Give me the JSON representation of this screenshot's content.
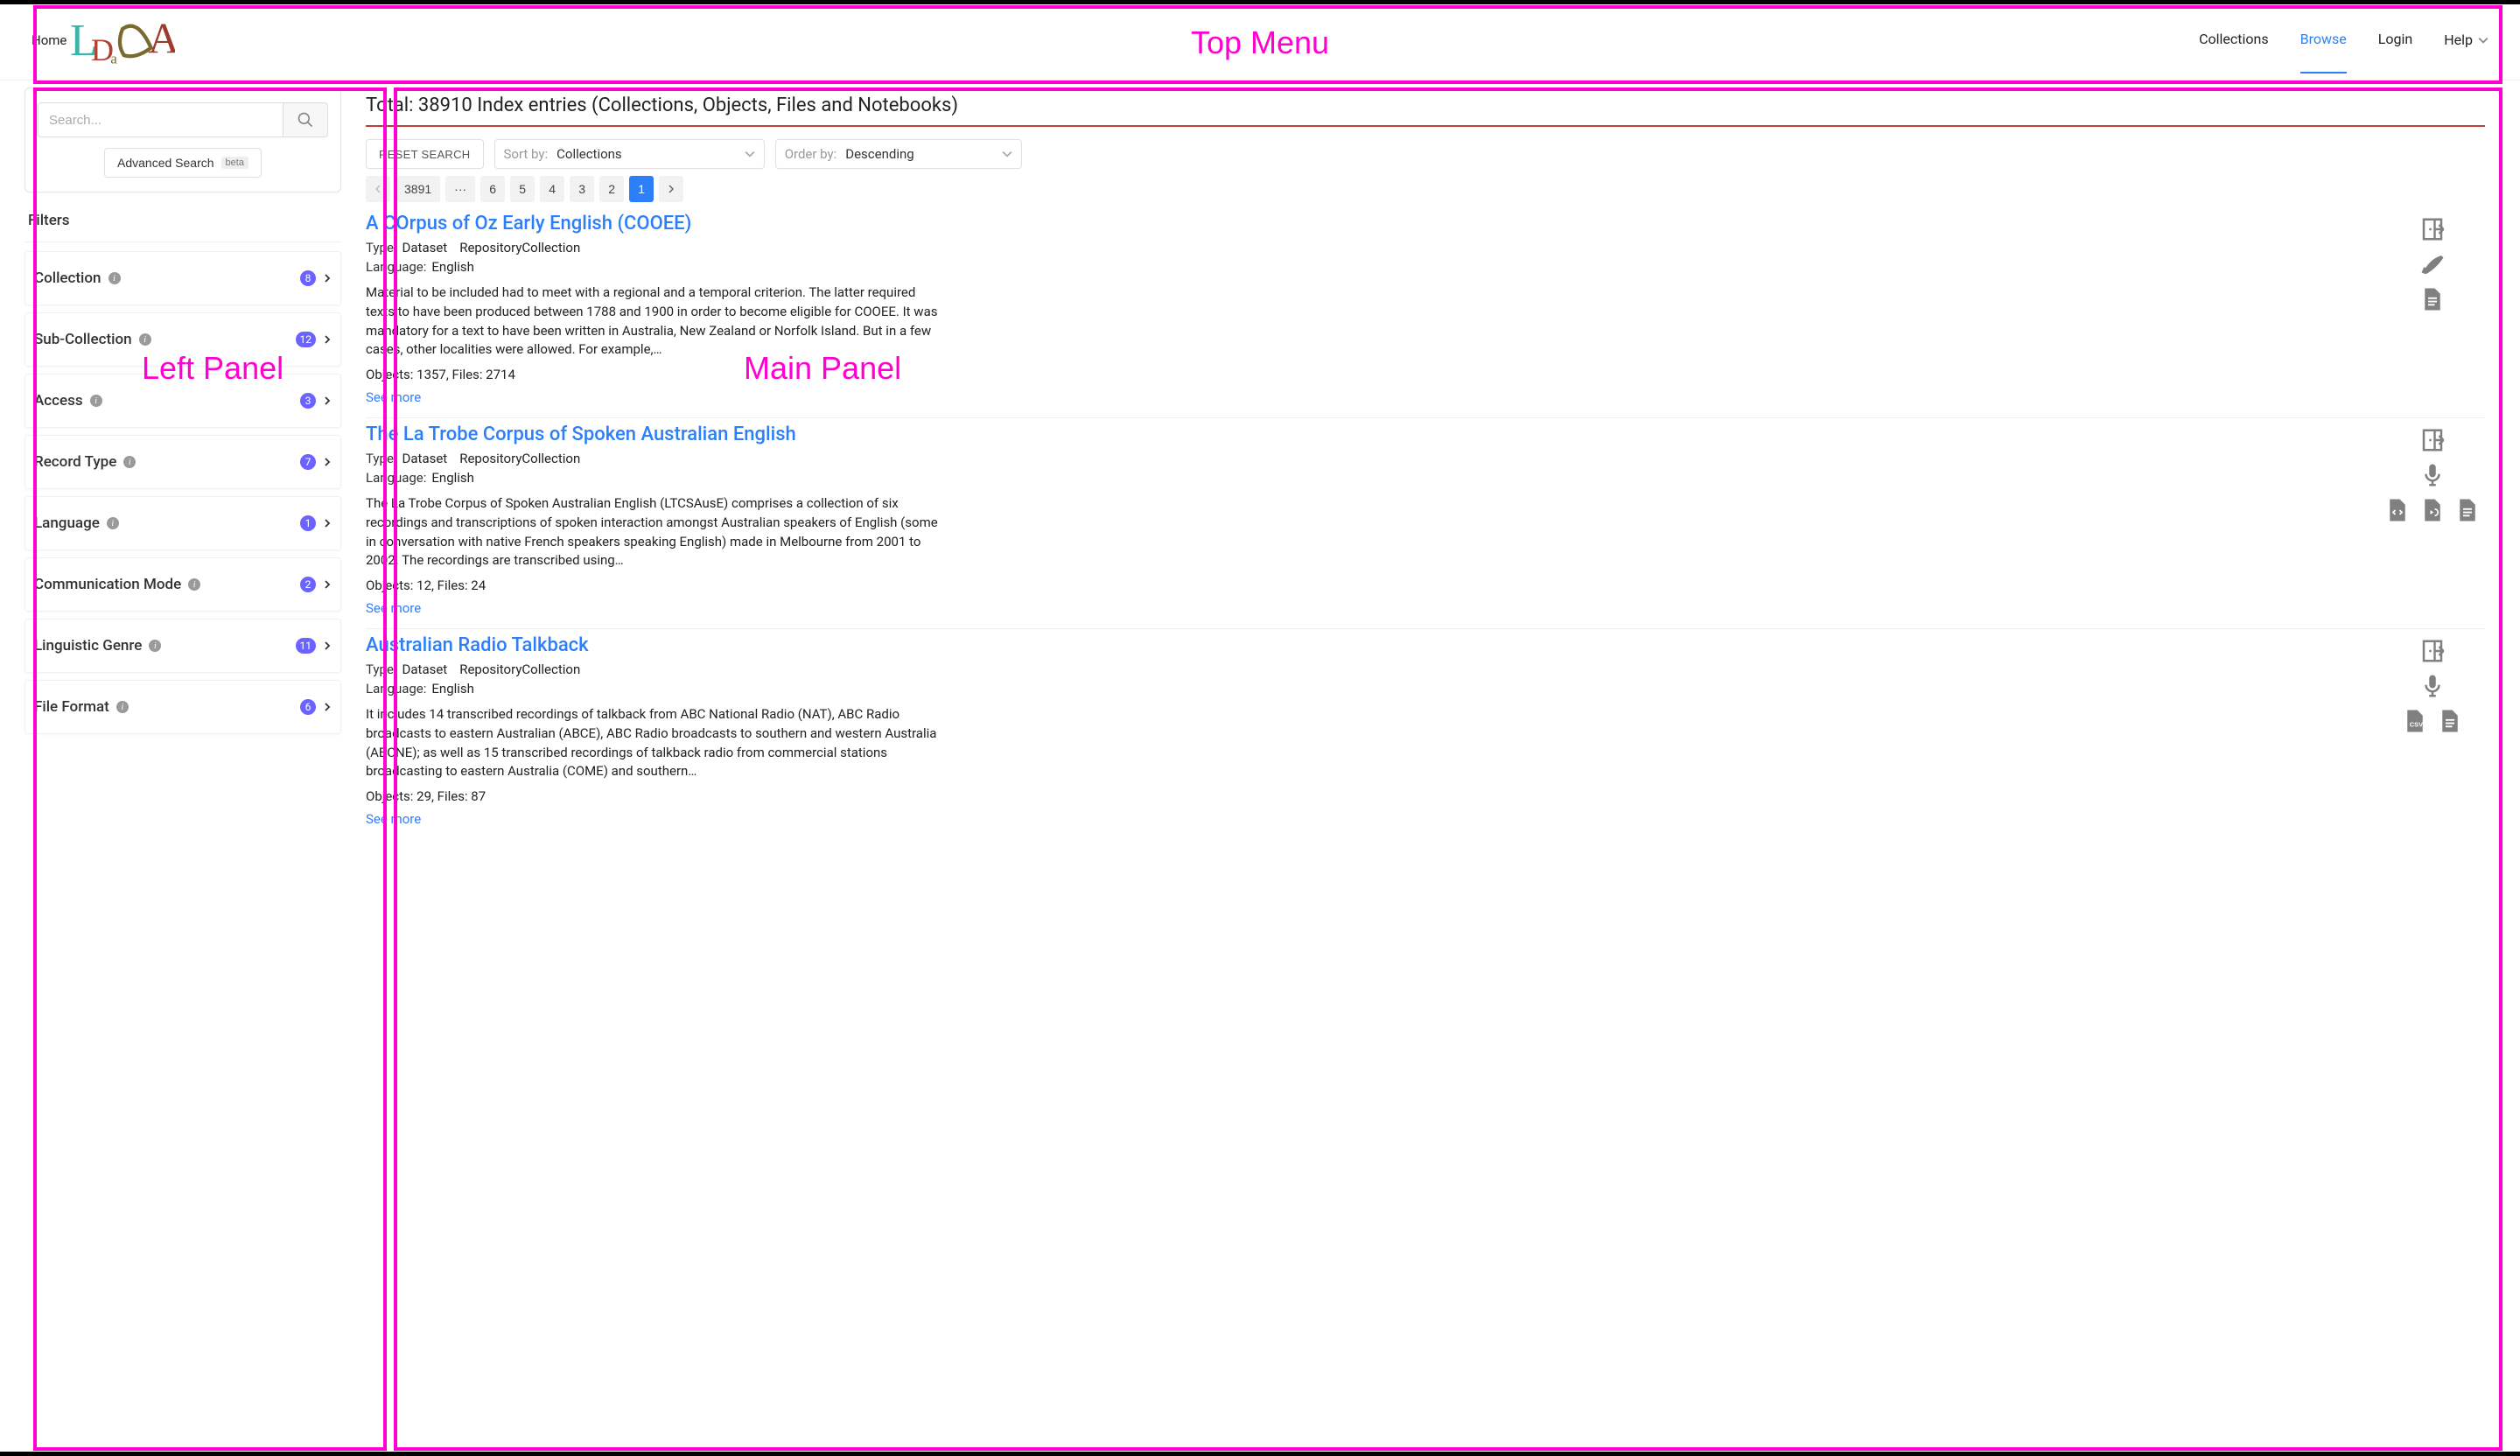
{
  "annotations": {
    "top_menu_label": "Top Menu",
    "left_panel_label": "Left Panel",
    "main_panel_label": "Main Panel"
  },
  "header": {
    "home_label": "Home",
    "nav": {
      "collections": "Collections",
      "browse": "Browse",
      "login": "Login",
      "help": "Help"
    }
  },
  "search": {
    "placeholder": "Search...",
    "advanced_label": "Advanced Search",
    "beta_label": "beta"
  },
  "filters": {
    "title": "Filters",
    "facets": [
      {
        "label": "Collection",
        "count": "8"
      },
      {
        "label": "Sub-Collection",
        "count": "12"
      },
      {
        "label": "Access",
        "count": "3"
      },
      {
        "label": "Record Type",
        "count": "7"
      },
      {
        "label": "Language",
        "count": "1"
      },
      {
        "label": "Communication Mode",
        "count": "2"
      },
      {
        "label": "Linguistic Genre",
        "count": "11"
      },
      {
        "label": "File Format",
        "count": "6"
      }
    ]
  },
  "main": {
    "total_line": "Total: 38910 Index entries (Collections, Objects, Files and Notebooks)",
    "reset_label": "RESET SEARCH",
    "sort": {
      "label": "Sort by:",
      "value": "Collections"
    },
    "order": {
      "label": "Order by:",
      "value": "Descending"
    },
    "pages": [
      "1",
      "2",
      "3",
      "4",
      "5",
      "6",
      "···",
      "3891"
    ],
    "active_page": "1",
    "results": [
      {
        "title": "A COrpus of Oz Early English (COOEE)",
        "type_label": "Type:",
        "types": [
          "Dataset",
          "RepositoryCollection"
        ],
        "lang_label": "Language:",
        "lang": "English",
        "desc": "Material to be included had to meet with a regional and a temporal criterion. The latter required texts to have been produced between 1788 and 1900 in order to become eligible for COOEE. It was mandatory for a text to have been written in Australia, New Zealand or Norfolk Island. But in a few cases, other localities were allowed. For example,…",
        "stats": "Objects: 1357, Files: 2714",
        "see_more": "See more",
        "icons": [
          "door",
          "pencil",
          "file-text"
        ]
      },
      {
        "title": "The La Trobe Corpus of Spoken Australian English",
        "type_label": "Type:",
        "types": [
          "Dataset",
          "RepositoryCollection"
        ],
        "lang_label": "Language:",
        "lang": "English",
        "desc": "The La Trobe Corpus of Spoken Australian English (LTCSAusE) comprises a collection of six recordings and transcriptions of spoken interaction amongst Australian speakers of English (some in conversation with native French speakers speaking English) made in Melbourne from 2001 to 2002. The recordings are transcribed using…",
        "stats": "Objects: 12, Files: 24",
        "see_more": "See more",
        "icons": [
          "door",
          "mic",
          "file-code file-audio file-text"
        ]
      },
      {
        "title": "Australian Radio Talkback",
        "type_label": "Type:",
        "types": [
          "Dataset",
          "RepositoryCollection"
        ],
        "lang_label": "Language:",
        "lang": "English",
        "desc": "It includes 14 transcribed recordings of talkback from ABC National Radio (NAT), ABC Radio broadcasts to eastern Australian (ABCE), ABC Radio broadcasts to southern and western Australia (ABCNE); as well as 15 transcribed recordings of talkback radio from commercial stations broadcasting to eastern Australia (COME) and southern…",
        "stats": "Objects: 29, Files: 87",
        "see_more": "See more",
        "icons": [
          "door",
          "mic",
          "file-csv file-text"
        ]
      }
    ]
  }
}
